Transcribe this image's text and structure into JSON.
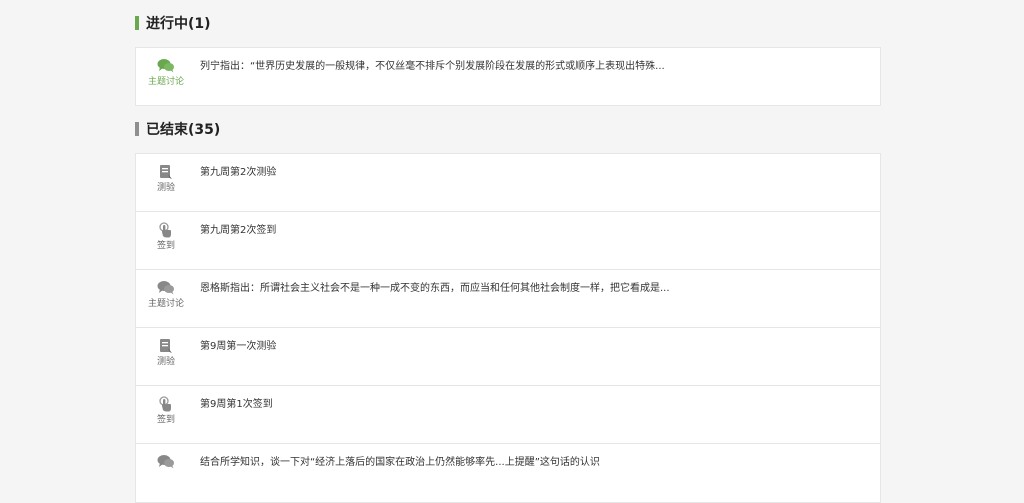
{
  "ongoing": {
    "title": "进行中(1)",
    "items": [
      {
        "type_label": "主题讨论",
        "icon": "chat-bubbles-icon",
        "text": "列宁指出：“世界历史发展的一般规律，不仅丝毫不排斥个别发展阶段在发展的形式或顺序上表现出特殊..."
      }
    ]
  },
  "ended": {
    "title": "已结束(35)",
    "items": [
      {
        "type_label": "测验",
        "icon": "quiz-icon",
        "text": "第九周第2次测验"
      },
      {
        "type_label": "签到",
        "icon": "sign-in-hand-icon",
        "text": "第九周第2次签到"
      },
      {
        "type_label": "主题讨论",
        "icon": "chat-bubbles-icon",
        "text": "恩格斯指出：所谓社会主义社会不是一种一成不变的东西，而应当和任何其他社会制度一样，把它看成是..."
      },
      {
        "type_label": "测验",
        "icon": "quiz-icon",
        "text": "第9周第一次测验"
      },
      {
        "type_label": "签到",
        "icon": "sign-in-hand-icon",
        "text": "第9周第1次签到"
      },
      {
        "type_label": "",
        "icon": "chat-bubbles-icon",
        "text": "结合所学知识，谈一下对“经济上落后的国家在政治上仍然能够率先...上提醒”这句话的认识"
      }
    ]
  },
  "colors": {
    "accent_green": "#6aa84f",
    "muted_gray": "#8f8f8f",
    "icon_gray": "#888888"
  }
}
